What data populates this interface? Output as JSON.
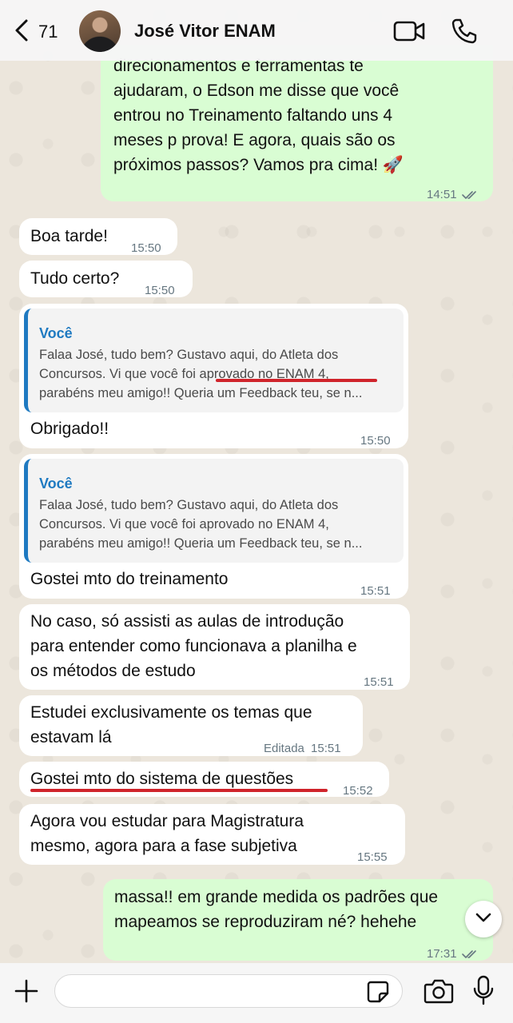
{
  "header": {
    "back_count": "71",
    "contact_name": "José Vitor ENAM"
  },
  "messages": [
    {
      "id": "m1",
      "direction": "out",
      "text": "direcionamentos e ferramentas te\najudaram, o Edson me disse que você\nentrou no Treinamento faltando uns 4\nmeses p prova! E agora, quais são os\npróximos passos? Vamos pra cima! 🚀",
      "time": "14:51",
      "read": true
    },
    {
      "id": "m2",
      "direction": "in",
      "text": "Boa tarde!",
      "time": "15:50"
    },
    {
      "id": "m3",
      "direction": "in",
      "text": "Tudo certo?",
      "time": "15:50"
    },
    {
      "id": "m4",
      "direction": "in",
      "quote": {
        "author": "Você",
        "text": "Falaa José, tudo bem? Gustavo aqui, do Atleta dos\nConcursos. Vi que você foi aprovado no ENAM 4,\nparabéns meu amigo!! Queria um Feedback teu, se n..."
      },
      "text": "Obrigado!!",
      "time": "15:50"
    },
    {
      "id": "m5",
      "direction": "in",
      "quote": {
        "author": "Você",
        "text": "Falaa José, tudo bem? Gustavo aqui, do Atleta dos\nConcursos. Vi que você foi aprovado no ENAM 4,\nparabéns meu amigo!! Queria um Feedback teu, se n..."
      },
      "text": "Gostei mto do treinamento",
      "time": "15:51"
    },
    {
      "id": "m6",
      "direction": "in",
      "text": "No caso, só assisti as aulas de introdução\npara entender como funcionava a planilha e\nos métodos de estudo",
      "time": "15:51"
    },
    {
      "id": "m7",
      "direction": "in",
      "text": "Estudei exclusivamente os temas que\nestavam lá",
      "time": "15:51",
      "edited_label": "Editada"
    },
    {
      "id": "m8",
      "direction": "in",
      "text": "Gostei mto do sistema de questões",
      "time": "15:52"
    },
    {
      "id": "m9",
      "direction": "in",
      "text": "Agora vou estudar para Magistratura\nmesmo, agora para a fase subjetiva",
      "time": "15:55"
    },
    {
      "id": "m10",
      "direction": "out",
      "text": "massa!! em grande medida os padrões que\nmapeamos se reproduziram né? hehehe",
      "time": "17:31",
      "read": true
    }
  ],
  "annotations": {
    "underline_color": "#d0242b"
  },
  "colors": {
    "outgoing_bubble": "#d9fdd3",
    "incoming_bubble": "#ffffff",
    "quote_accent": "#1f7ac1",
    "read_ticks": "#667781"
  },
  "composer": {
    "value": "",
    "placeholder": ""
  },
  "icons": [
    "chevron-left-icon",
    "video-camera-icon",
    "phone-icon",
    "plus-icon",
    "sticker-icon",
    "camera-icon",
    "microphone-icon",
    "chevron-down-icon"
  ]
}
